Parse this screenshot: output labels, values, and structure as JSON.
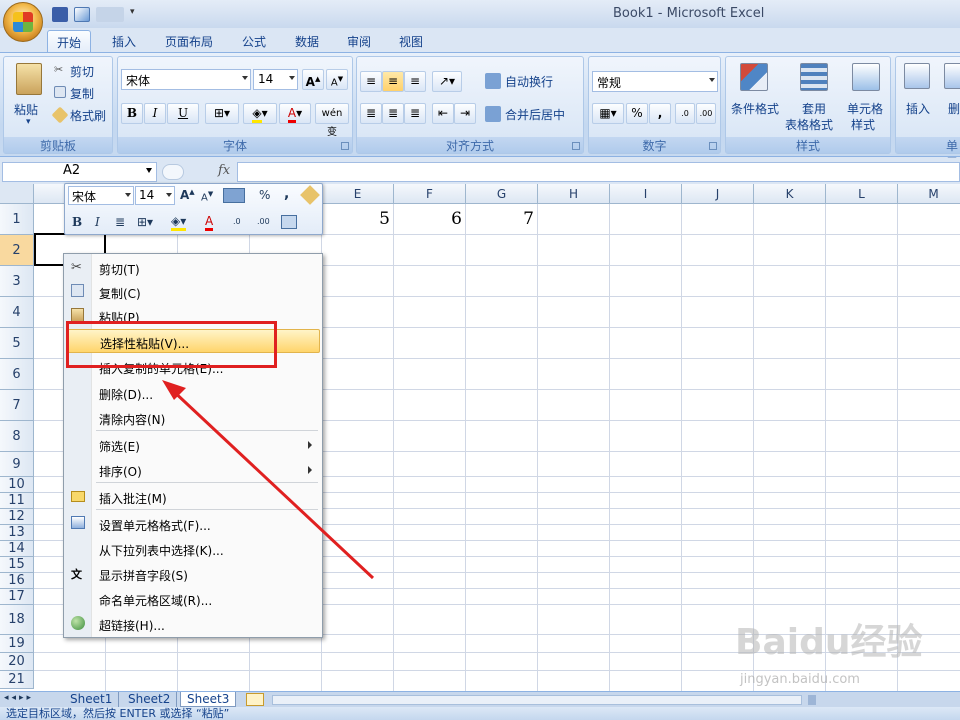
{
  "window": {
    "title": "Book1 - Microsoft Excel"
  },
  "tabs": [
    "开始",
    "插入",
    "页面布局",
    "公式",
    "数据",
    "审阅",
    "视图"
  ],
  "ribbon": {
    "clipboard": {
      "label": "剪贴板",
      "paste": "粘贴",
      "cut": "剪切",
      "copy": "复制",
      "format_painter": "格式刷"
    },
    "font": {
      "label": "字体",
      "font_name": "宋体",
      "font_size": "14",
      "bold": "B",
      "italic": "I",
      "underline": "U",
      "phonetic": "wén 变"
    },
    "alignment": {
      "label": "对齐方式",
      "wrap_text": "自动换行",
      "merge_center": "合并后居中"
    },
    "number": {
      "label": "数字",
      "format": "常规",
      "percent": "%",
      "comma": ","
    },
    "styles": {
      "label": "样式",
      "conditional": "条件格式",
      "table_format_1": "套用",
      "table_format_2": "表格格式",
      "cell_styles_1": "单元格",
      "cell_styles_2": "样式"
    },
    "cells": {
      "label": "单元",
      "insert": "插入",
      "delete": "删"
    }
  },
  "formula_bar": {
    "name_box": "A2",
    "fx": "fx"
  },
  "columns": [
    "E",
    "F",
    "G",
    "H",
    "I",
    "J",
    "K",
    "L",
    "M"
  ],
  "rows": [
    "1",
    "2",
    "3",
    "4",
    "5",
    "6",
    "7",
    "8",
    "9",
    "10",
    "11",
    "12",
    "13",
    "14",
    "15",
    "16",
    "17",
    "18",
    "19",
    "20",
    "21"
  ],
  "cells": {
    "E1": "5",
    "F1": "6",
    "G1": "7"
  },
  "mini_toolbar": {
    "font_name": "宋体",
    "font_size": "14",
    "percent": "%",
    "comma": ",",
    "bold": "B",
    "italic": "I"
  },
  "context_menu": [
    {
      "label": "剪切(T)",
      "icon": "scissors-icon"
    },
    {
      "label": "复制(C)",
      "icon": "copy-icon"
    },
    {
      "label": "粘贴(P)",
      "icon": "paste-icon"
    },
    {
      "label": "选择性粘贴(V)...",
      "icon": ""
    },
    {
      "label": "插入复制的单元格(E)...",
      "icon": ""
    },
    {
      "label": "删除(D)...",
      "icon": ""
    },
    {
      "label": "清除内容(N)",
      "icon": ""
    },
    {
      "label": "筛选(E)",
      "icon": "",
      "submenu": true
    },
    {
      "label": "排序(O)",
      "icon": "",
      "submenu": true
    },
    {
      "label": "插入批注(M)",
      "icon": "comment-icon"
    },
    {
      "label": "设置单元格格式(F)...",
      "icon": "format-cells-icon"
    },
    {
      "label": "从下拉列表中选择(K)...",
      "icon": ""
    },
    {
      "label": "显示拼音字段(S)",
      "icon": "phonetic-icon"
    },
    {
      "label": "命名单元格区域(R)...",
      "icon": ""
    },
    {
      "label": "超链接(H)...",
      "icon": "hyperlink-icon"
    }
  ],
  "sheets": [
    "Sheet1",
    "Sheet2",
    "Sheet3"
  ],
  "status": "选定目标区域，然后按 ENTER 或选择 “粘贴”",
  "watermark": {
    "brand": "Baidu经验",
    "url": "jingyan.baidu.com"
  },
  "colors": {
    "highlight": "#ffd56c",
    "annotation": "#e02020",
    "accent": "#15428b"
  }
}
